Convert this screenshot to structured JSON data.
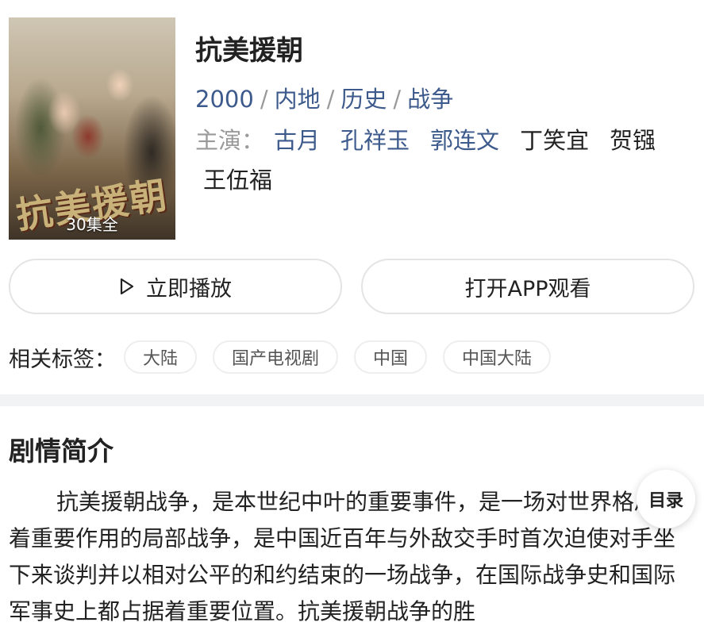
{
  "show": {
    "title": "抗美援朝",
    "poster_logo": "抗美援朝",
    "episodes_badge": "30集全",
    "year": "2000",
    "region": "内地",
    "genres": [
      "历史",
      "战争"
    ],
    "cast_label": "主演：",
    "cast": [
      {
        "name": "古月",
        "linked": true
      },
      {
        "name": "孔祥玉",
        "linked": true
      },
      {
        "name": "郭连文",
        "linked": true
      },
      {
        "name": "丁笑宜",
        "linked": false
      },
      {
        "name": "贺镪",
        "linked": false
      },
      {
        "name": "王伍福",
        "linked": false
      }
    ]
  },
  "actions": {
    "play_label": "立即播放",
    "open_app_label": "打开APP观看"
  },
  "tags": {
    "label": "相关标签：",
    "items": [
      "大陆",
      "国产电视剧",
      "中国",
      "中国大陆"
    ]
  },
  "synopsis": {
    "title": "剧情简介",
    "text": "抗美援朝战争，是本世纪中叶的重要事件，是一场对世界格局起着重要作用的局部战争，是中国近百年与外敌交手时首次迫使对手坐下来谈判并以相对公平的和约结束的一场战争，在国际战争史和国际军事史上都占据着重要位置。抗美援朝战争的胜"
  },
  "toc_button": "目录",
  "colors": {
    "link": "#3d5a8c",
    "muted": "#9a9a9a",
    "divider": "#f2f3f5"
  }
}
